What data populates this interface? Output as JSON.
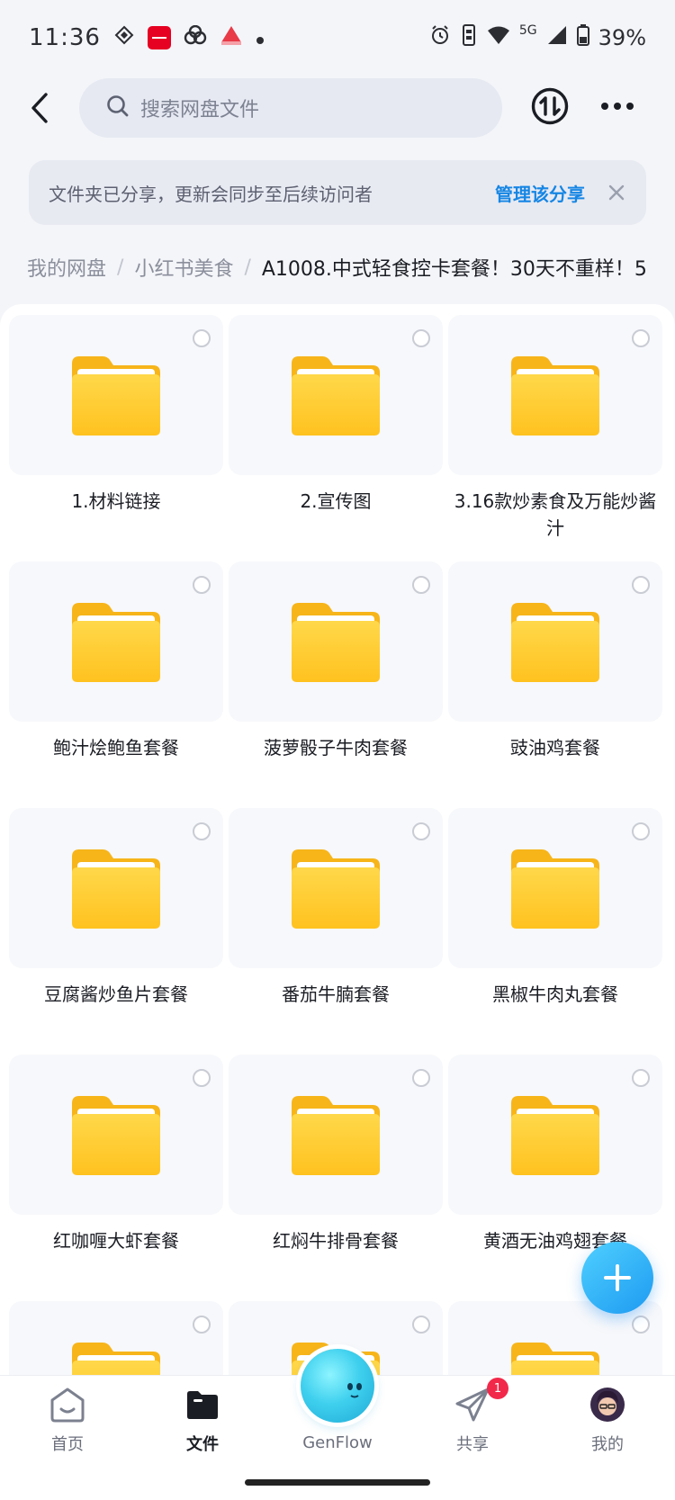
{
  "status_bar": {
    "time": "11:36",
    "network": "5G",
    "battery": "39%",
    "icons": [
      "tiktok-icon",
      "xiaohongshu-badge",
      "cloud-app-icon",
      "game-app-icon",
      "alarm-icon",
      "vibrate-icon",
      "wifi-icon",
      "signal-icon",
      "battery-icon"
    ]
  },
  "header": {
    "search_placeholder": "搜索网盘文件"
  },
  "banner": {
    "text": "文件夹已分享，更新会同步至后续访问者",
    "manage_label": "管理该分享"
  },
  "breadcrumb": {
    "items": [
      "我的网盘",
      "小红书美食"
    ],
    "current": "A1008.中式轻食控卡套餐！30天不重样！5"
  },
  "folders": [
    {
      "name": "1.材料链接"
    },
    {
      "name": "2.宣传图"
    },
    {
      "name": "3.16款炒素食及万能炒酱汁"
    },
    {
      "name": "鲍汁烩鲍鱼套餐"
    },
    {
      "name": "菠萝骰子牛肉套餐"
    },
    {
      "name": "豉油鸡套餐"
    },
    {
      "name": "豆腐酱炒鱼片套餐"
    },
    {
      "name": "番茄牛腩套餐"
    },
    {
      "name": "黑椒牛肉丸套餐"
    },
    {
      "name": "红咖喱大虾套餐"
    },
    {
      "name": "红焖牛排骨套餐"
    },
    {
      "name": "黄酒无油鸡翅套餐"
    },
    {
      "name": ""
    },
    {
      "name": ""
    },
    {
      "name": ""
    }
  ],
  "bottom_nav": {
    "items": [
      {
        "label": "首页",
        "icon": "home-icon"
      },
      {
        "label": "文件",
        "icon": "folder-icon",
        "active": true
      },
      {
        "label": "GenFlow",
        "icon": "genflow-orb"
      },
      {
        "label": "共享",
        "icon": "share-plane-icon",
        "badge": "1"
      },
      {
        "label": "我的",
        "icon": "avatar"
      }
    ]
  },
  "colors": {
    "accent": "#1686e4",
    "folder_yellow": "#ffcc33",
    "badge_red": "#f2284a"
  }
}
